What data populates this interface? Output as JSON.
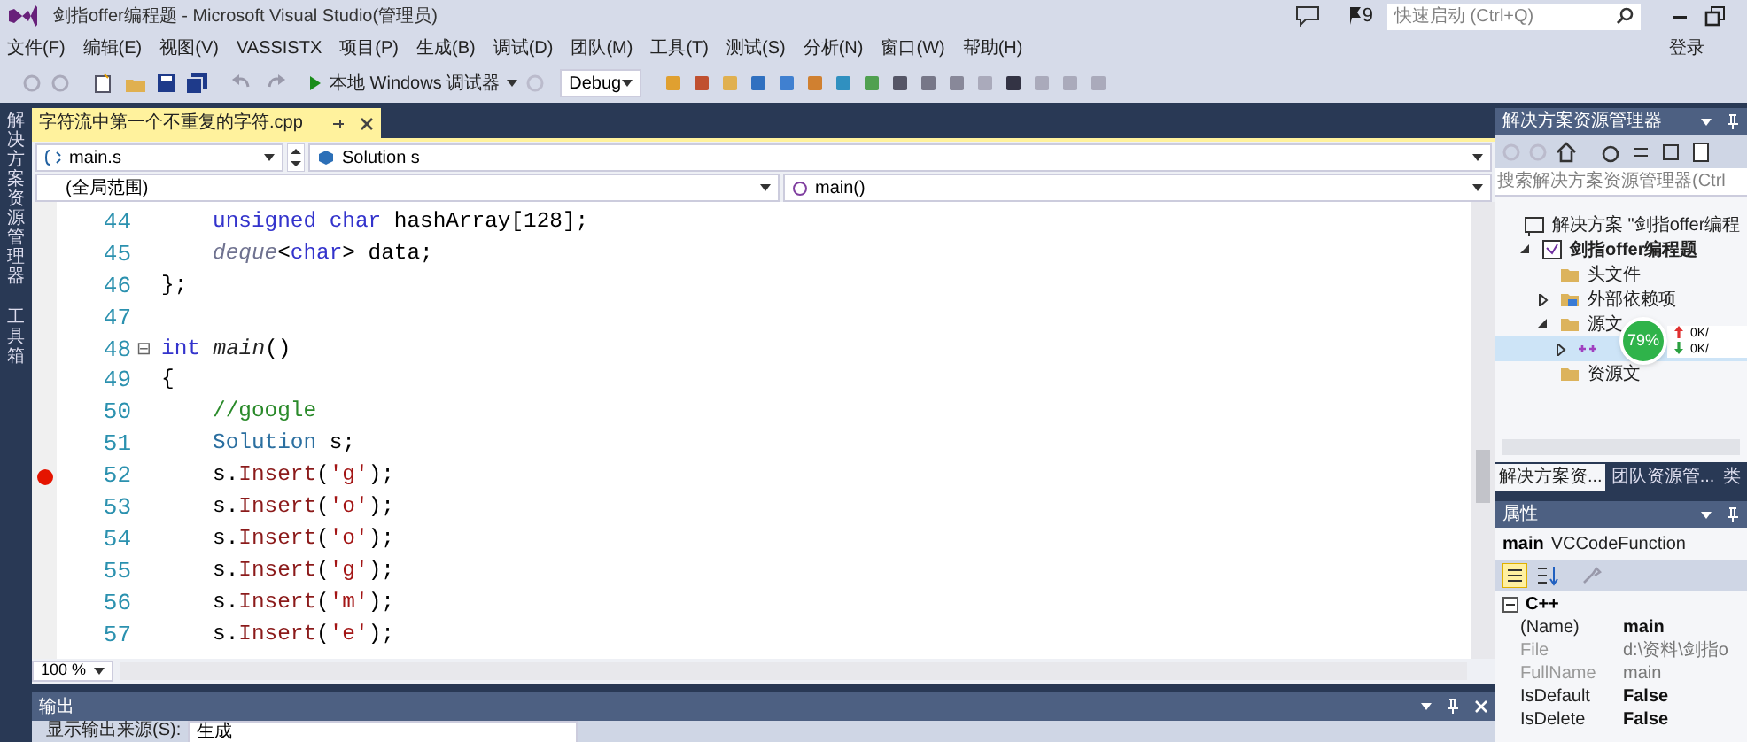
{
  "window": {
    "title": "剑指offer编程题 - Microsoft Visual Studio(管理员)",
    "notification_count": "9",
    "quick_launch": {
      "placeholder": "快速启动 (Ctrl+Q)"
    },
    "sign_in": "登录"
  },
  "menu": [
    "文件(F)",
    "编辑(E)",
    "视图(V)",
    "VASSISTX",
    "项目(P)",
    "生成(B)",
    "调试(D)",
    "团队(M)",
    "工具(T)",
    "测试(S)",
    "分析(N)",
    "窗口(W)",
    "帮助(H)"
  ],
  "toolbar": {
    "debugger": "本地 Windows 调试器",
    "configuration": "Debug"
  },
  "side_tabs": [
    "解决方案资源管理器",
    "工具箱"
  ],
  "editor": {
    "tab": {
      "title": "字符流中第一个不重复的字符.cpp",
      "selected": true
    },
    "nav": {
      "project": "main.s",
      "type": "Solution s",
      "scope": "(全局范围)",
      "member": "main()"
    },
    "lines": [
      {
        "number": "44",
        "breakpoint": false,
        "tokens": [
          {
            "kind": "keyword",
            "text": "unsigned char"
          },
          {
            "kind": "plain",
            "text": " hashArray[128];"
          }
        ]
      },
      {
        "number": "45",
        "breakpoint": false,
        "tokens": [
          {
            "kind": "template",
            "text": "deque"
          },
          {
            "kind": "plain",
            "text": "<"
          },
          {
            "kind": "keyword",
            "text": "char"
          },
          {
            "kind": "plain",
            "text": "> data;"
          }
        ]
      },
      {
        "number": "46",
        "breakpoint": false,
        "tokens": [
          {
            "kind": "plain",
            "text": "};"
          }
        ]
      },
      {
        "number": "47",
        "breakpoint": false
      },
      {
        "number": "48",
        "breakpoint": false,
        "fold": "⊟",
        "tokens": [
          {
            "kind": "keyword",
            "text": "int"
          },
          {
            "kind": "function",
            "text": " main"
          },
          {
            "kind": "plain",
            "text": "()"
          }
        ]
      },
      {
        "number": "49",
        "breakpoint": false,
        "tokens": [
          {
            "kind": "plain",
            "text": "{"
          }
        ]
      },
      {
        "number": "50",
        "breakpoint": false,
        "tokens": [
          {
            "kind": "comment",
            "text": "//google"
          }
        ]
      },
      {
        "number": "51",
        "breakpoint": false,
        "tokens": [
          {
            "kind": "type",
            "text": "Solution"
          },
          {
            "kind": "plain",
            "text": " s;"
          }
        ]
      },
      {
        "number": "52",
        "breakpoint": true,
        "tokens": [
          {
            "kind": "plain",
            "text": "s."
          },
          {
            "kind": "method",
            "text": "Insert"
          },
          {
            "kind": "plain",
            "text": "("
          },
          {
            "kind": "char",
            "text": "'g'"
          },
          {
            "kind": "plain",
            "text": ");"
          }
        ]
      },
      {
        "number": "53",
        "breakpoint": false,
        "tokens": [
          {
            "kind": "plain",
            "text": "s."
          },
          {
            "kind": "method",
            "text": "Insert"
          },
          {
            "kind": "plain",
            "text": "("
          },
          {
            "kind": "char",
            "text": "'o'"
          },
          {
            "kind": "plain",
            "text": ");"
          }
        ]
      },
      {
        "number": "54",
        "breakpoint": false,
        "tokens": [
          {
            "kind": "plain",
            "text": "s."
          },
          {
            "kind": "method",
            "text": "Insert"
          },
          {
            "kind": "plain",
            "text": "("
          },
          {
            "kind": "char",
            "text": "'o'"
          },
          {
            "kind": "plain",
            "text": ");"
          }
        ]
      },
      {
        "number": "55",
        "breakpoint": false,
        "tokens": [
          {
            "kind": "plain",
            "text": "s."
          },
          {
            "kind": "method",
            "text": "Insert"
          },
          {
            "kind": "plain",
            "text": "("
          },
          {
            "kind": "char",
            "text": "'g'"
          },
          {
            "kind": "plain",
            "text": ");"
          }
        ]
      },
      {
        "number": "56",
        "breakpoint": false,
        "tokens": [
          {
            "kind": "plain",
            "text": "s."
          },
          {
            "kind": "method",
            "text": "Insert"
          },
          {
            "kind": "plain",
            "text": "("
          },
          {
            "kind": "char",
            "text": "'m'"
          },
          {
            "kind": "plain",
            "text": ");"
          }
        ]
      },
      {
        "number": "57",
        "breakpoint": false,
        "tokens": [
          {
            "kind": "plain",
            "text": "s."
          },
          {
            "kind": "method",
            "text": "Insert"
          },
          {
            "kind": "plain",
            "text": "("
          },
          {
            "kind": "char",
            "text": "'e'"
          },
          {
            "kind": "plain",
            "text": ");"
          }
        ]
      }
    ],
    "zoom": "100 %"
  },
  "output": {
    "title": "输出",
    "source_label": "显示输出来源(S):",
    "source": "生成"
  },
  "solution_explorer": {
    "title": "解决方案资源管理器",
    "search": {
      "placeholder": "搜索解决方案资源管理器(Ctrl"
    },
    "tree": [
      {
        "kind": "solution",
        "label": "解决方案 \"剑指offer编程",
        "selected": false,
        "children": [
          {
            "kind": "project",
            "label": "剑指offer编程题",
            "selected": false,
            "expanded": true,
            "children": [
              {
                "kind": "folder",
                "label": "头文件",
                "selected": false
              },
              {
                "kind": "deps",
                "label": "外部依赖项",
                "selected": false,
                "expanded": false
              },
              {
                "kind": "folder",
                "label": "源文",
                "selected": false,
                "expanded": true,
                "children": [
                  {
                    "kind": "file",
                    "selected": true,
                    "expanded": false
                  }
                ]
              },
              {
                "kind": "folder",
                "label": "资源文",
                "selected": false
              }
            ]
          }
        ]
      }
    ],
    "tabs": [
      {
        "label": "解决方案资...",
        "selected": true
      },
      {
        "label": "团队资源管...",
        "selected": false
      },
      {
        "label": "类",
        "selected": false
      }
    ]
  },
  "speed_widget": {
    "percent": "79%",
    "upload": "0K/",
    "download": "0K/"
  },
  "properties": {
    "title": "属性",
    "object": "main",
    "object_type": "VCCodeFunction",
    "category": "C++",
    "rows": [
      {
        "name": "(Name)",
        "value": "main",
        "disabled": false
      },
      {
        "name": "File",
        "value": "d:\\资料\\剑指o",
        "disabled": true
      },
      {
        "name": "FullName",
        "value": "main",
        "disabled": true
      },
      {
        "name": "IsDefault",
        "value": "False",
        "disabled": false
      },
      {
        "name": "IsDelete",
        "value": "False",
        "disabled": false
      }
    ]
  }
}
